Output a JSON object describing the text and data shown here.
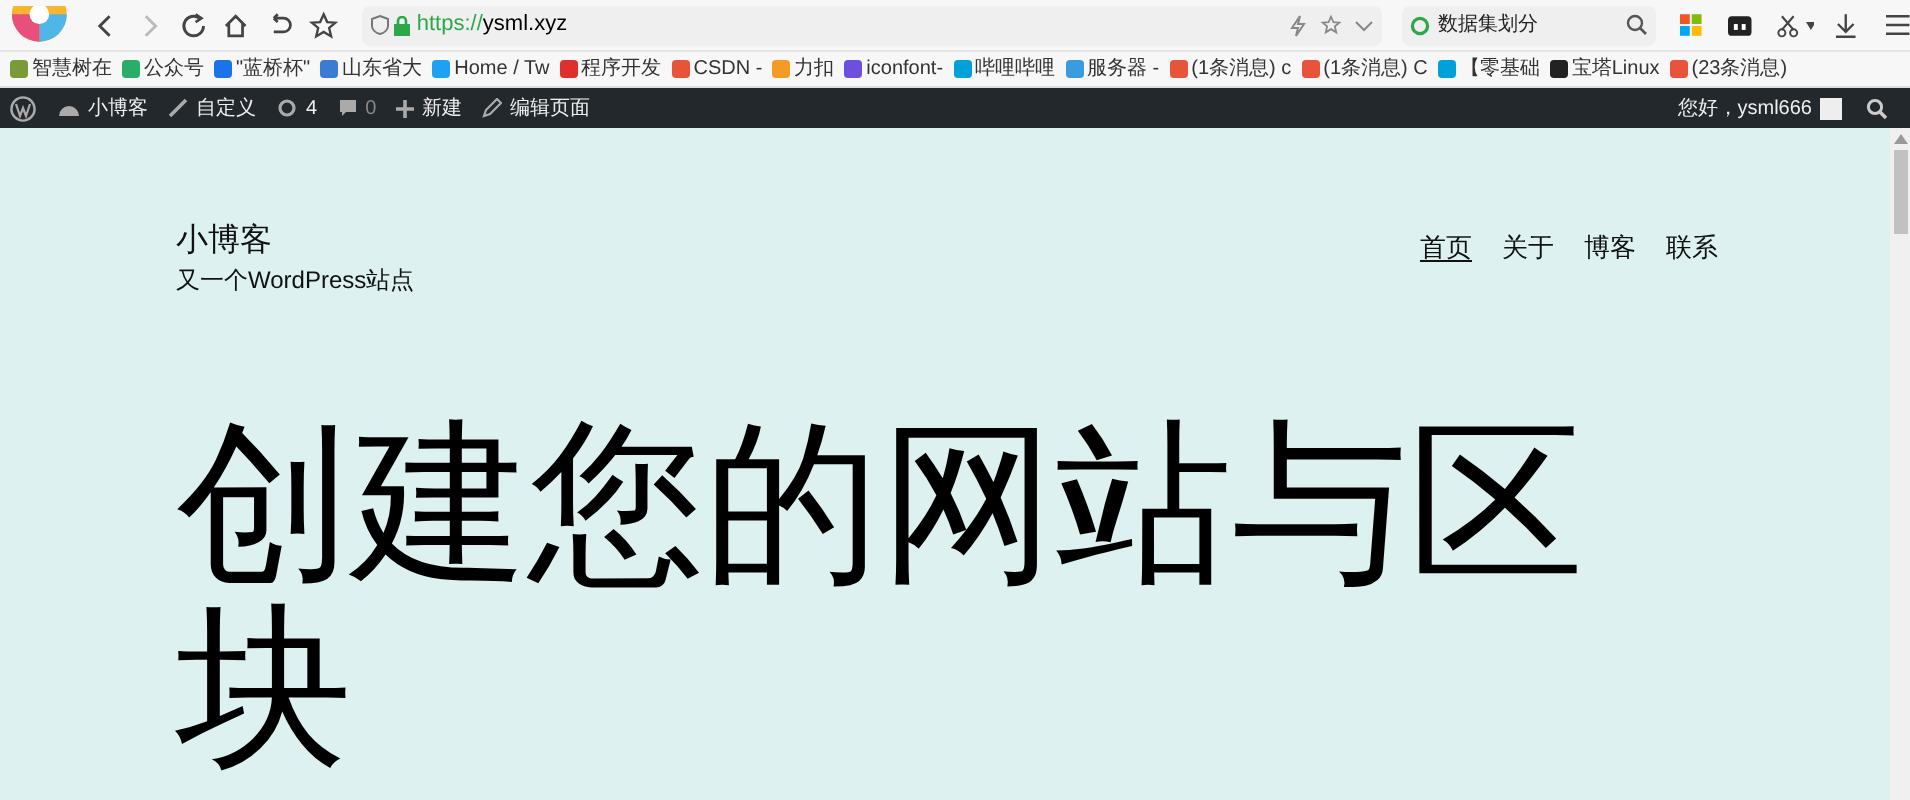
{
  "browser": {
    "url_scheme": "https://",
    "url_host": "ysml.xyz",
    "search_value": "数据集划分"
  },
  "bookmarks": [
    {
      "label": "智慧树在"
    },
    {
      "label": "公众号"
    },
    {
      "label": "\"蓝桥杯\""
    },
    {
      "label": "山东省大"
    },
    {
      "label": "Home / Tw"
    },
    {
      "label": "程序开发"
    },
    {
      "label": "CSDN -"
    },
    {
      "label": "力扣"
    },
    {
      "label": "iconfont-"
    },
    {
      "label": "哔哩哔哩"
    },
    {
      "label": "服务器 -"
    },
    {
      "label": "(1条消息) c"
    },
    {
      "label": "(1条消息) C"
    },
    {
      "label": "【零基础"
    },
    {
      "label": "宝塔Linux"
    },
    {
      "label": "(23条消息)"
    }
  ],
  "admin_bar": {
    "site": "小博客",
    "customize": "自定义",
    "updates": "4",
    "comments": "0",
    "new": "新建",
    "edit": "编辑页面",
    "greeting": "您好，ysml666"
  },
  "site": {
    "title": "小博客",
    "tagline": "又一个WordPress站点"
  },
  "nav": [
    {
      "label": "首页",
      "selected": true
    },
    {
      "label": "关于",
      "selected": false
    },
    {
      "label": "博客",
      "selected": false
    },
    {
      "label": "联系",
      "selected": false
    }
  ],
  "hero": {
    "heading": "创建您的网站与区块"
  }
}
